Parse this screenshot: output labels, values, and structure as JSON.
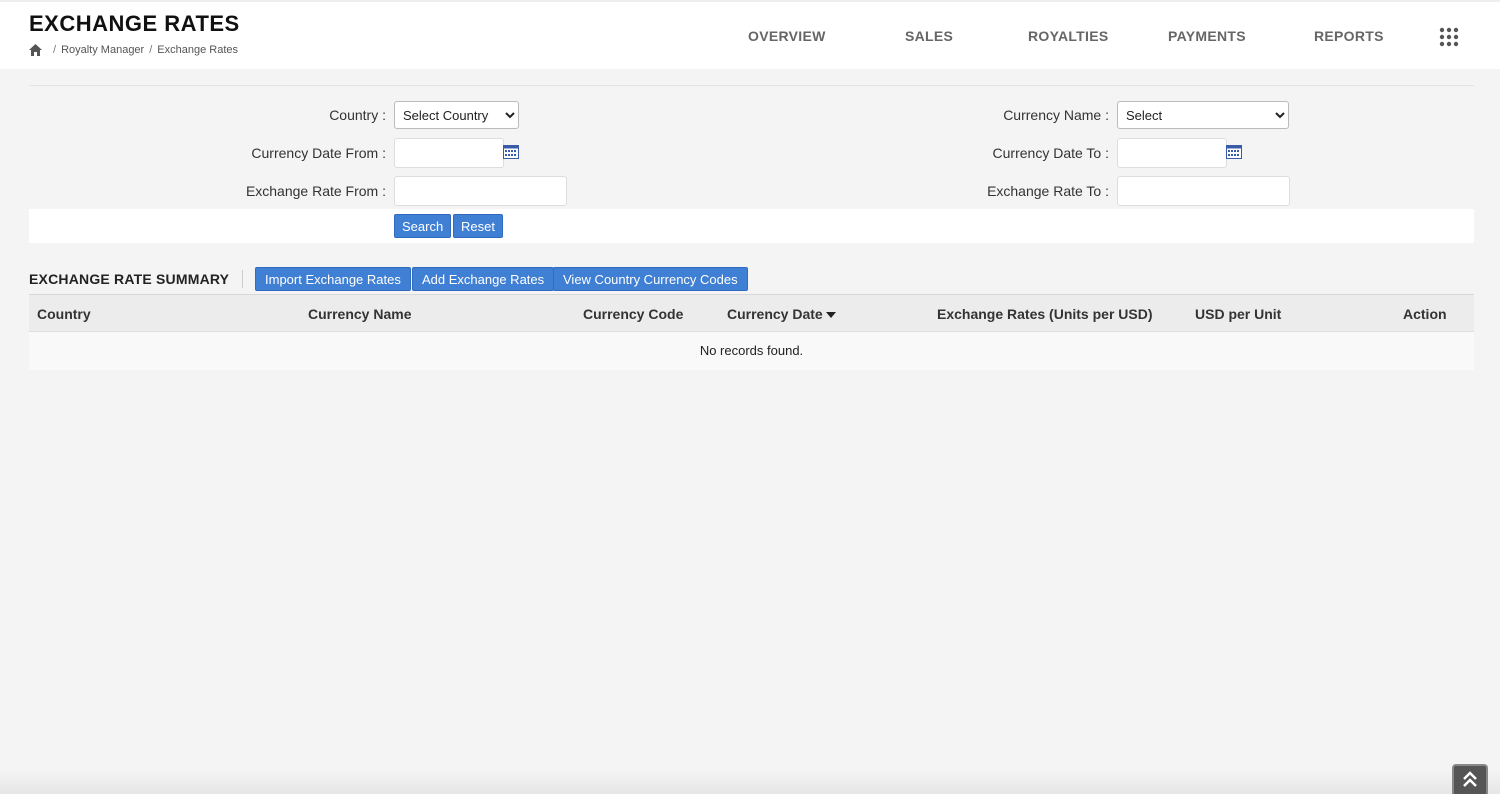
{
  "header": {
    "title": "EXCHANGE RATES",
    "breadcrumb": [
      "Royalty Manager",
      "Exchange Rates"
    ],
    "nav": [
      "OVERVIEW",
      "SALES",
      "ROYALTIES",
      "PAYMENTS",
      "REPORTS"
    ]
  },
  "filters": {
    "country_label": "Country :",
    "country_value": "Select Country",
    "currency_name_label": "Currency Name :",
    "currency_name_value": "Select",
    "date_from_label": "Currency Date From :",
    "date_to_label": "Currency Date To :",
    "rate_from_label": "Exchange Rate From :",
    "rate_to_label": "Exchange Rate To :",
    "search_label": "Search",
    "reset_label": "Reset"
  },
  "summary": {
    "title": "EXCHANGE RATE SUMMARY",
    "import_label": "Import Exchange Rates",
    "add_label": "Add Exchange Rates",
    "view_codes_label": "View Country Currency Codes",
    "columns": [
      "Country",
      "Currency Name",
      "Currency Code",
      "Currency Date",
      "Exchange Rates (Units per USD)",
      "USD per Unit",
      "Action"
    ],
    "empty_message": "No records found."
  },
  "colors": {
    "accent": "#3f7fd4",
    "background": "#f4f4f4"
  }
}
